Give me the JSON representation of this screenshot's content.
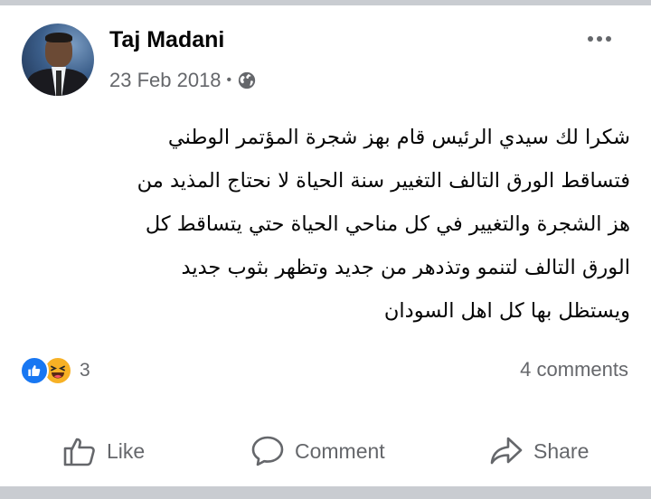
{
  "post": {
    "author": "Taj Madani",
    "date": "23 Feb 2018",
    "separator": "•",
    "privacy_icon": "globe-icon",
    "more_icon": "ellipsis-icon",
    "text_lines": [
      "شكرا لك سيدي الرئيس قام بهز شجرة المؤتمر الوطني",
      "فتساقط الورق التالف التغيير سنة الحياة لا نحتاج المذيد من",
      "هز الشجرة  والتغيير في كل مناحي الحياة حتي يتساقط كل",
      "الورق التالف لتنمو وتذدهر من جديد وتظهر بثوب جديد",
      "ويستظل بها كل اهل  السودان"
    ]
  },
  "reactions": {
    "icons": [
      "like-reaction-icon",
      "haha-reaction-icon"
    ],
    "count": "3"
  },
  "comments": {
    "label": "4 comments"
  },
  "actions": {
    "like": "Like",
    "comment": "Comment",
    "share": "Share"
  },
  "colors": {
    "background": "#ffffff",
    "divider_band": "#c9ccd1",
    "secondary_text": "#65676b",
    "like_blue": "#1877f2",
    "haha_yellow": "#f7b125"
  }
}
